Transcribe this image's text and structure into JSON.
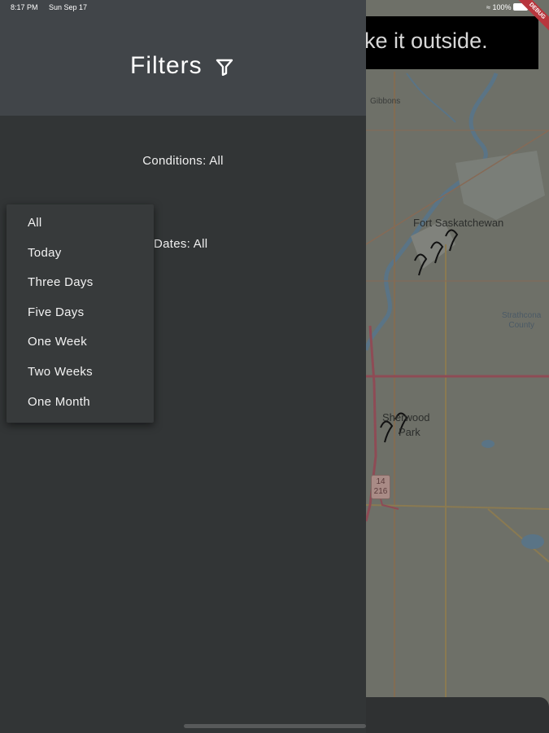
{
  "status_bar": {
    "time": "8:17 PM",
    "date": "Sun Sep 17",
    "battery": "100%",
    "debug_ribbon": "DEBUG"
  },
  "map": {
    "banner_text": "ke it outside.",
    "labels": {
      "gibbons": "Gibbons",
      "fort_saskatchewan": "Fort Saskatchewan",
      "sherwood_park_line1": "Sherwood",
      "sherwood_park_line2": "Park",
      "county_line1": "Strathcona",
      "county_line2": "County",
      "hwy_14": "14",
      "hwy_216": "216"
    }
  },
  "drawer": {
    "title": "Filters",
    "title_icon": "filter-icon",
    "conditions_label": "Conditions: All",
    "dates_prefix": "",
    "dates_label": "Dates: All"
  },
  "date_menu": {
    "options": [
      "All",
      "Today",
      "Three Days",
      "Five Days",
      "One Week",
      "Two Weeks",
      "One Month"
    ]
  },
  "colors": {
    "drawer_bg": "#323536",
    "drawer_header_bg": "#414549",
    "menu_bg": "#373a3b",
    "text": "#ffffff"
  }
}
